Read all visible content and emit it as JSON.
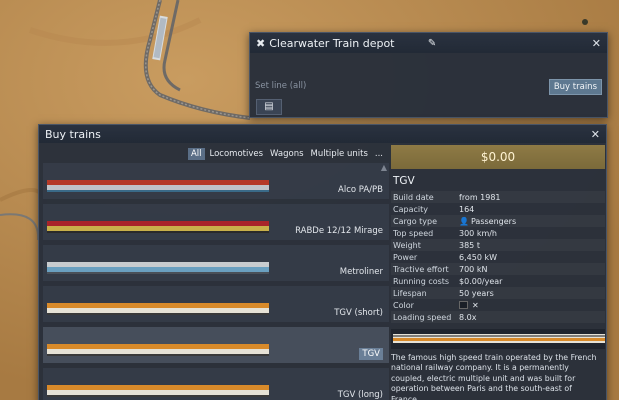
{
  "depot": {
    "title": "Clearwater Train depot",
    "line_select": "Set line (all)",
    "buy_button": "Buy trains",
    "close": "✕"
  },
  "buy": {
    "title": "Buy trains",
    "close": "✕",
    "filters": [
      "All",
      "Locomotives",
      "Wagons",
      "Multiple units",
      "..."
    ],
    "trains": [
      {
        "label": "Alco PA/PB",
        "colors": [
          "#b53a28",
          "#c0c4c8",
          "#3a6a88"
        ]
      },
      {
        "label": "RABDe 12/12 Mirage",
        "colors": [
          "#a8242a",
          "#c8b04a",
          "#2a2a2a"
        ]
      },
      {
        "label": "Metroliner",
        "colors": [
          "#c8cccf",
          "#6aa0c0",
          "#4a5058"
        ]
      },
      {
        "label": "TGV (short)",
        "colors": [
          "#d88a2a",
          "#e6e2d6",
          "#3a3a3a"
        ]
      },
      {
        "label": "TGV",
        "colors": [
          "#d88a2a",
          "#e6e2d6",
          "#3a3a3a"
        ]
      },
      {
        "label": "TGV (long)",
        "colors": [
          "#d88a2a",
          "#e6e2d6",
          "#3a3a3a"
        ]
      }
    ],
    "selected_index": 4,
    "details": {
      "price": "$0.00",
      "name": "TGV",
      "properties": [
        {
          "k": "Build date",
          "v": "from 1981"
        },
        {
          "k": "Capacity",
          "v": "164"
        },
        {
          "k": "Cargo type",
          "v": "Passengers"
        },
        {
          "k": "Top speed",
          "v": "300 km/h"
        },
        {
          "k": "Weight",
          "v": "385 t"
        },
        {
          "k": "Power",
          "v": "6,450 kW"
        },
        {
          "k": "Tractive effort",
          "v": "700 kN"
        },
        {
          "k": "Running costs",
          "v": "$0.00/year"
        },
        {
          "k": "Lifespan",
          "v": "50 years"
        },
        {
          "k": "Color",
          "v": "✕"
        },
        {
          "k": "Loading speed",
          "v": "8.0x"
        }
      ],
      "description": "The famous high speed train operated by the French national railway company. It is a permanently coupled, electric multiple unit and was built for operation between Paris and the south-east of France."
    }
  }
}
